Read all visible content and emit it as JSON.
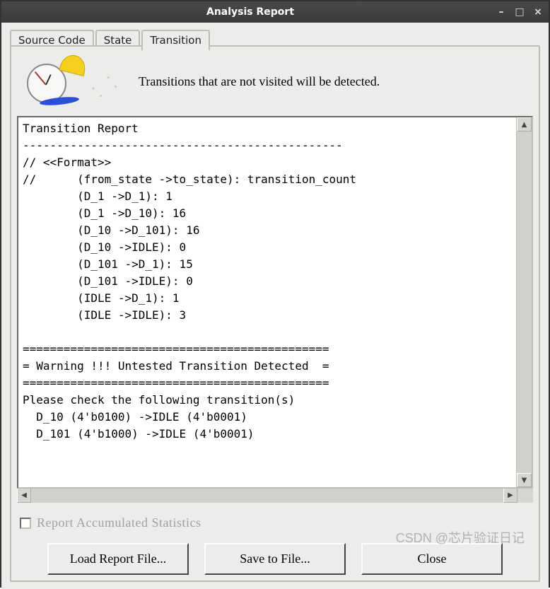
{
  "window": {
    "title": "Analysis Report",
    "minimize_icon": "minimize",
    "maximize_icon": "maximize",
    "close_icon": "close"
  },
  "tabs": {
    "items": [
      {
        "label": "Source Code",
        "active": false
      },
      {
        "label": "State",
        "active": false
      },
      {
        "label": "Transition",
        "active": true
      }
    ]
  },
  "header": {
    "description": "Transitions that are not visited will be detected."
  },
  "report": {
    "title": "Transition Report",
    "divider": "-----------------------------------------------",
    "format_header": "// <<Format>>",
    "format_line": "//      (from_state ->to_state): transition_count",
    "transitions": [
      {
        "from": "D_1",
        "to": "D_1",
        "count": 1
      },
      {
        "from": "D_1",
        "to": "D_10",
        "count": 16
      },
      {
        "from": "D_10",
        "to": "D_101",
        "count": 16
      },
      {
        "from": "D_10",
        "to": "IDLE",
        "count": 0
      },
      {
        "from": "D_101",
        "to": "D_1",
        "count": 15
      },
      {
        "from": "D_101",
        "to": "IDLE",
        "count": 0
      },
      {
        "from": "IDLE",
        "to": "D_1",
        "count": 1
      },
      {
        "from": "IDLE",
        "to": "IDLE",
        "count": 3
      }
    ],
    "warning_border": "=============================================",
    "warning_text": "= Warning !!! Untested Transition Detected  =",
    "please_check": "Please check the following transition(s)",
    "untested": [
      {
        "from": "D_10",
        "from_code": "4'b0100",
        "to": "IDLE",
        "to_code": "4'b0001"
      },
      {
        "from": "D_101",
        "from_code": "4'b1000",
        "to": "IDLE",
        "to_code": "4'b0001"
      }
    ]
  },
  "checkbox": {
    "label": "Report Accumulated Statistics",
    "checked": false,
    "enabled": false
  },
  "buttons": {
    "load": "Load Report File...",
    "save": "Save to File...",
    "close": "Close"
  },
  "watermark": "CSDN @芯片验证日记"
}
